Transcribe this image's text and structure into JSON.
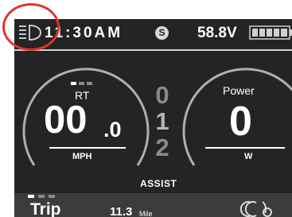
{
  "status_bar": {
    "headlight_icon": "headlight-icon",
    "time": "11:30AM",
    "mode_badge": "S",
    "voltage": "58.8V",
    "battery_icon": "battery-icon"
  },
  "speed_gauge": {
    "label": "RT",
    "value_integer": "00",
    "value_decimal": ".0",
    "unit": "MPH"
  },
  "assist": {
    "levels": [
      "0",
      "1",
      "2"
    ],
    "current_level": "1",
    "label": "ASSIST"
  },
  "power_gauge": {
    "label": "Power",
    "value": "0",
    "unit": "W"
  },
  "trip": {
    "label": "Trip",
    "value": "11.3",
    "unit": "Mile"
  },
  "brand_logo": "brand-logo-icon",
  "colors": {
    "screen_bg": "#242424",
    "gauge_arc": "#b0b0b0",
    "trip_bar_bg": "#3c3c3c",
    "annotation": "#e0332d"
  }
}
